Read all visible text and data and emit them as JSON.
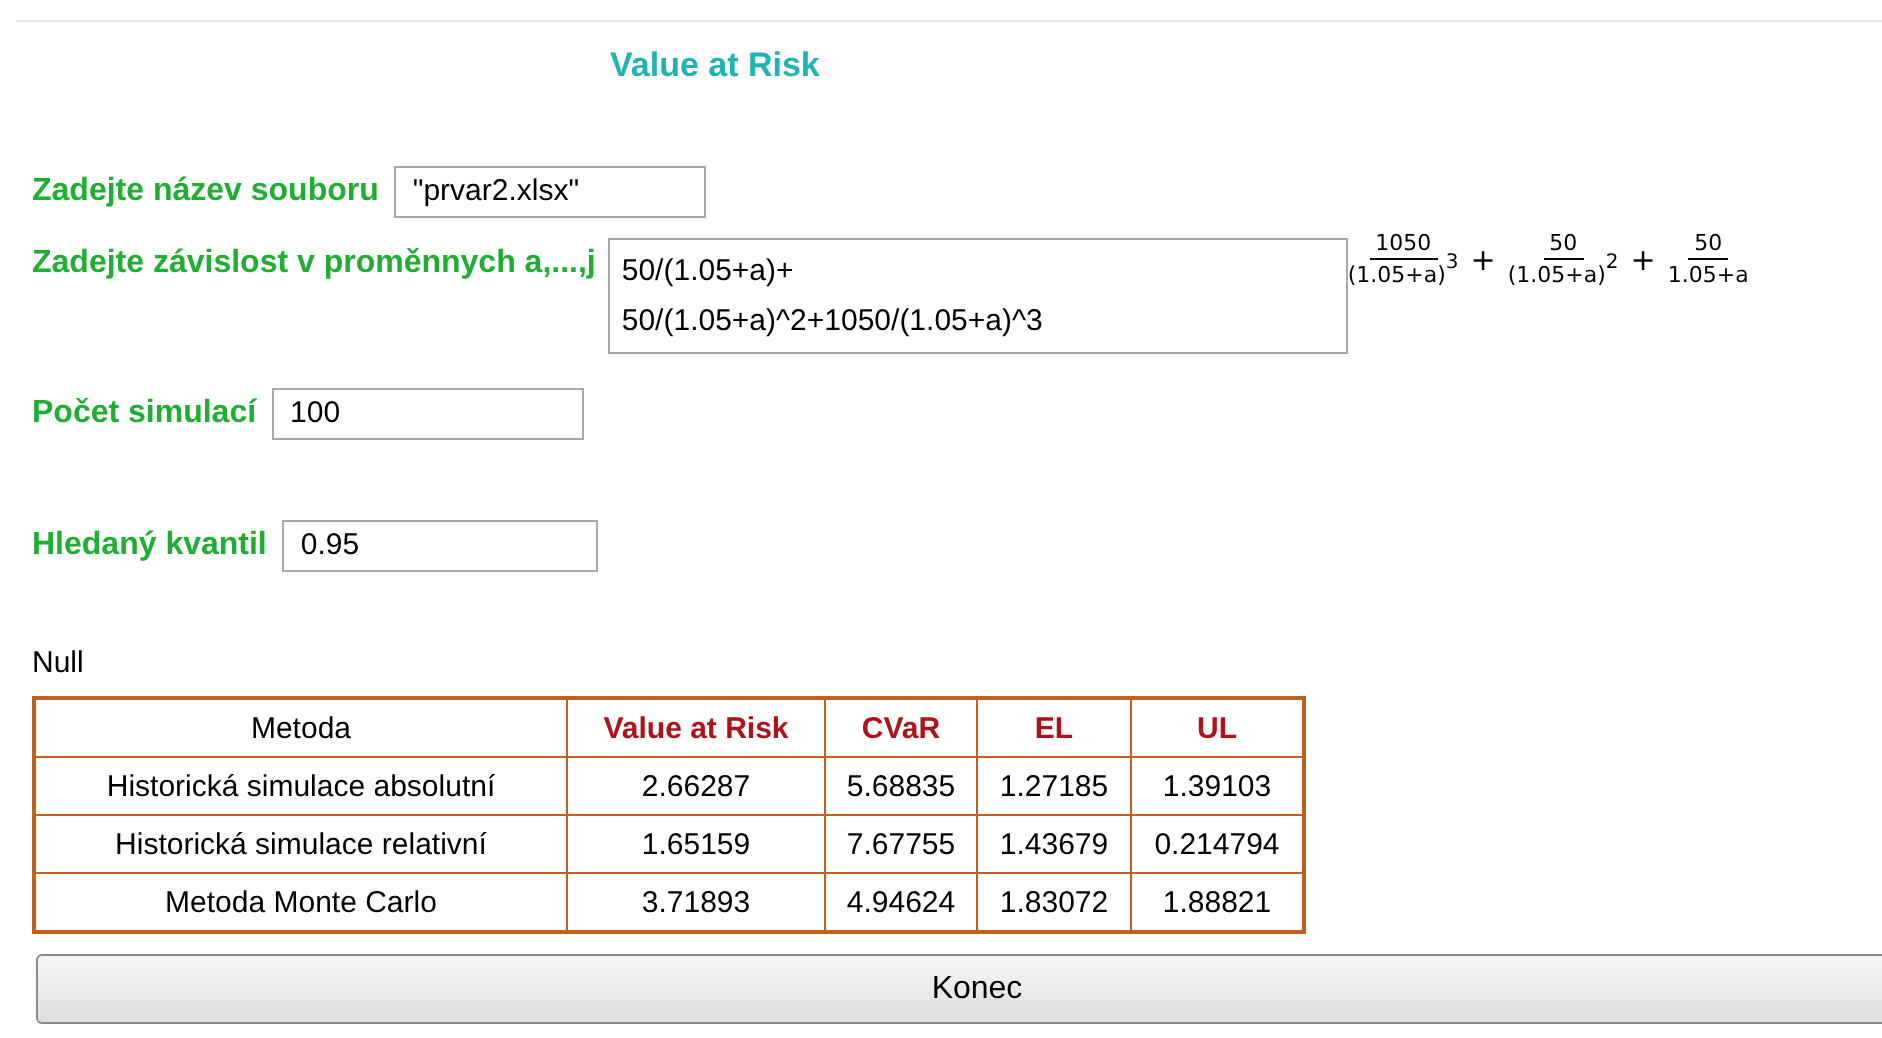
{
  "title": "Value at Risk",
  "fields": [
    {
      "label": "Zadejte název souboru",
      "kind": "line",
      "value": "\"prvar2.xlsx\""
    },
    {
      "label": "Zadejte závislost v proměnnych a,...,j",
      "kind": "area",
      "value": "50/(1.05+a)+\n50/(1.05+a)^2+1050/(1.05+a)^3"
    },
    {
      "label": "Počet simulací",
      "kind": "line",
      "value": "100"
    },
    {
      "label": "Hledaný kvantil",
      "kind": "line",
      "value": "0.95"
    }
  ],
  "formula": [
    {
      "numerator": "1050",
      "denominator": "(1.05+a)",
      "exponent": "3"
    },
    {
      "numerator": "50",
      "denominator": "(1.05+a)",
      "exponent": "2"
    },
    {
      "numerator": "50",
      "denominator": "1.05+a"
    }
  ],
  "formula_operator": "+",
  "status": "Null",
  "table": {
    "columns": [
      "Metoda",
      "Value at Risk",
      "CVaR",
      "EL",
      "UL"
    ],
    "rows": [
      [
        "Historická simulace absolutní",
        "2.66287",
        "5.68835",
        "1.27185",
        "1.39103"
      ],
      [
        "Historická simulace relativní",
        "1.65159",
        "7.67755",
        "1.43679",
        "0.214794"
      ],
      [
        "Metoda Monte Carlo",
        "3.71893",
        "4.94624",
        "1.83072",
        "1.88821"
      ]
    ]
  },
  "button": "Konec"
}
